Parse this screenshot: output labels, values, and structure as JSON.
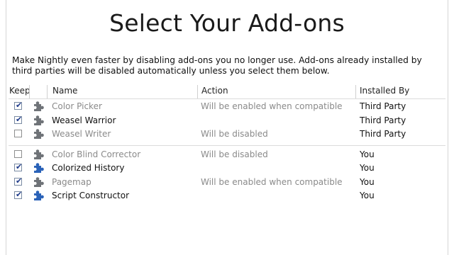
{
  "title": "Select Your Add-ons",
  "description": "Make Nightly even faster by disabling add-ons you no longer use. Add-ons already installed by third parties will be disabled automatically unless you select them below.",
  "columns": {
    "keep": "Keep",
    "name": "Name",
    "action": "Action",
    "installed_by": "Installed By"
  },
  "groups": [
    {
      "rows": [
        {
          "keep": true,
          "name": "Color Picker",
          "action": "Will be enabled when compatible",
          "installed_by": "Third Party",
          "dimmed": true,
          "icon": "puzzle-icon-gray"
        },
        {
          "keep": true,
          "name": "Weasel Warrior",
          "action": "",
          "installed_by": "Third Party",
          "dimmed": false,
          "icon": "puzzle-icon-gray"
        },
        {
          "keep": false,
          "name": "Weasel Writer",
          "action": "Will be disabled",
          "installed_by": "Third Party",
          "dimmed": true,
          "icon": "puzzle-icon-gray"
        }
      ]
    },
    {
      "rows": [
        {
          "keep": false,
          "name": "Color Blind Corrector",
          "action": "Will be disabled",
          "installed_by": "You",
          "dimmed": true,
          "icon": "puzzle-icon-gray"
        },
        {
          "keep": true,
          "name": "Colorized History",
          "action": "",
          "installed_by": "You",
          "dimmed": false,
          "icon": "puzzle-icon-blue"
        },
        {
          "keep": true,
          "name": "Pagemap",
          "action": "Will be enabled when compatible",
          "installed_by": "You",
          "dimmed": true,
          "icon": "puzzle-icon-gray"
        },
        {
          "keep": true,
          "name": "Script Constructor",
          "action": "",
          "installed_by": "You",
          "dimmed": false,
          "icon": "puzzle-icon-blue"
        }
      ]
    }
  ],
  "colors": {
    "icon_gray": "#6f7378",
    "icon_blue": "#2a62b8",
    "dim_text": "#8a8a8a",
    "checkmark": "#1e3a8a"
  }
}
